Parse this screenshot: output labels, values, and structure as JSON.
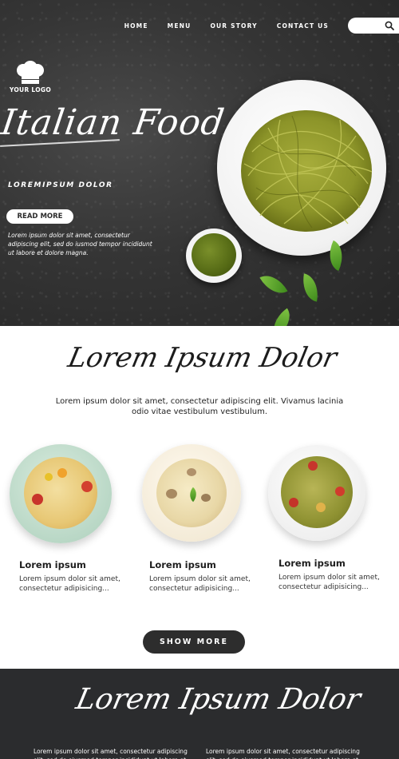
{
  "nav": {
    "items": [
      "HOME",
      "MENU",
      "OUR STORY",
      "CONTACT US"
    ]
  },
  "search": {
    "icon": "search-icon"
  },
  "brand": {
    "logo_text": "YOUR LOGO",
    "logo_icon": "chef-hat-icon"
  },
  "hero": {
    "title": "Italian Food",
    "subtitle": "LOREMIPSUM DOLOR",
    "button_label": "READ MORE",
    "description": "Lorem ipsum dolor sit amet, consectetur adipiscing elit, sed do iusmod tempor incididunt ut labore et dolore magna."
  },
  "section": {
    "title": "Lorem Ipsum Dolor",
    "description": "Lorem ipsum dolor sit amet, consectetur adipiscing elit. Vivamus lacinia odio vitae vestibulum vestibulum."
  },
  "dishes": [
    {
      "title": "Lorem ipsum",
      "text": "Lorem ipsum dolor sit amet, consectetur  adipisicing..."
    },
    {
      "title": "Lorem ipsum",
      "text": "Lorem ipsum dolor sit amet, consectetur  adipisicing..."
    },
    {
      "title": "Lorem ipsum",
      "text": "Lorem ipsum dolor sit amet, consectetur  adipisicing..."
    }
  ],
  "show_more_label": "SHOW MORE",
  "footer": {
    "title": "Lorem Ipsum Dolor",
    "col1": "Lorem ipsum dolor sit amet, consectetur adipiscing elit, sed do eiusmod tempor incididunt ut labore et dolore magna.",
    "col2": "Lorem ipsum dolor sit amet, consectetur adipiscing elit, sed do eiusmod tempor incididunt ut labore et dolore magna."
  },
  "colors": {
    "hero_bg": "#353535",
    "footer_bg": "#2b2c2e",
    "button_dark": "#2d2d2d",
    "pesto_green": "#6f8a22"
  }
}
